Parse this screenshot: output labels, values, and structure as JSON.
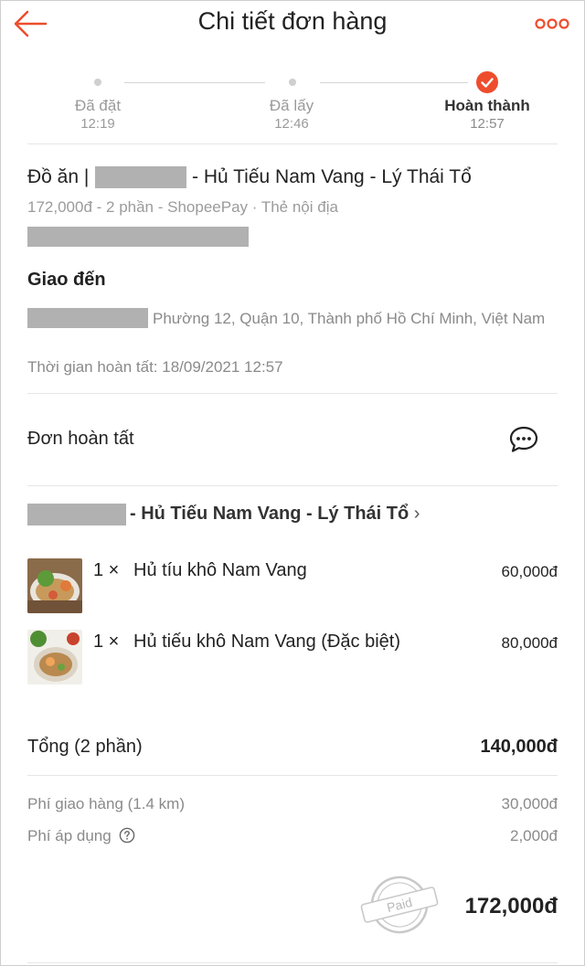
{
  "colors": {
    "accent": "#ee4d2d",
    "muted": "#9b9b9b",
    "redaction": "#b1b1b1"
  },
  "header": {
    "title": "Chi tiết đơn hàng",
    "back_icon": "arrow-left-icon",
    "more_icon": "more-dots-icon"
  },
  "progress": {
    "steps": [
      {
        "label": "Đã đặt",
        "time": "12:19"
      },
      {
        "label": "Đã lấy",
        "time": "12:46"
      },
      {
        "label": "Hoàn thành",
        "time": "12:57"
      }
    ]
  },
  "order": {
    "prefix": "Đồ ăn |",
    "shop_suffix": "- Hủ Tiếu Nam Vang - Lý Thái Tổ",
    "meta": "172,000đ - 2 phần - ShopeePay · Thẻ nội địa"
  },
  "delivery": {
    "title": "Giao đến",
    "address": "Phường 12, Quận 10, Thành phố Hồ Chí Minh, Việt Nam",
    "completed_time": "Thời gian hoàn tất: 18/09/2021 12:57"
  },
  "status": {
    "text": "Đơn hoàn tất",
    "chat_icon": "chat-bubble-icon"
  },
  "shop": {
    "name_suffix": "- Hủ Tiếu Nam Vang - Lý Thái Tổ",
    "chevron": "›"
  },
  "items": [
    {
      "qty": "1 ×",
      "name": "Hủ tíu khô Nam Vang",
      "price": "60,000đ"
    },
    {
      "qty": "1 ×",
      "name": "Hủ tiếu khô Nam Vang (Đặc biệt)",
      "price": "80,000đ"
    }
  ],
  "summary": {
    "total_label": "Tổng (2 phần)",
    "total_value": "140,000đ",
    "shipping_label": "Phí giao hàng (1.4 km)",
    "shipping_value": "30,000đ",
    "service_label": "Phí áp dụng",
    "service_value": "2,000đ",
    "grand_total": "172,000đ",
    "paid_stamp": "Paid"
  }
}
